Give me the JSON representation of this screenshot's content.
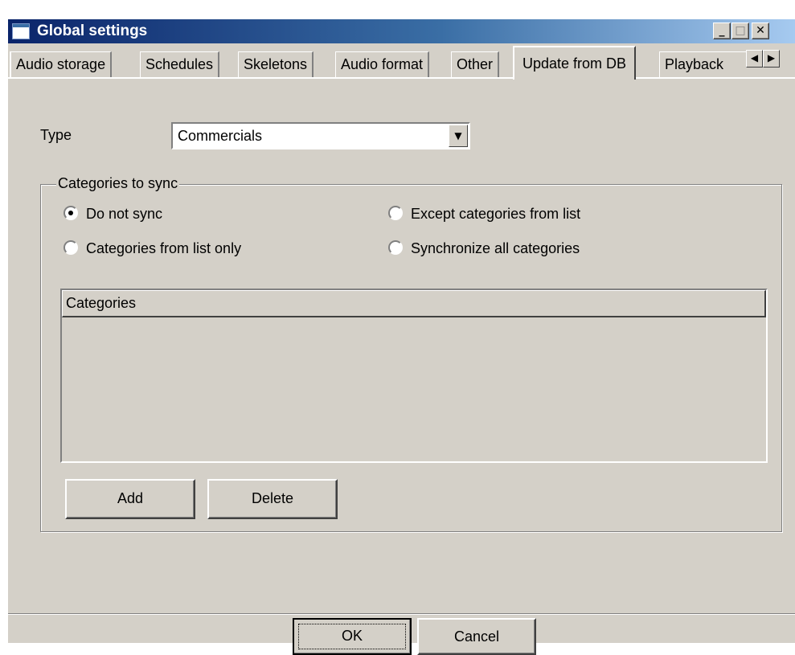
{
  "window": {
    "title": "Global settings"
  },
  "caption_buttons": {
    "minimize": "_",
    "maximize": "□",
    "close": "✕"
  },
  "tabs": [
    {
      "label": "Audio storage",
      "active": false
    },
    {
      "label": "Schedules",
      "active": false
    },
    {
      "label": "Skeletons",
      "active": false
    },
    {
      "label": "Audio format",
      "active": false
    },
    {
      "label": "Other",
      "active": false
    },
    {
      "label": "Update from DB",
      "active": true
    },
    {
      "label": "Playback",
      "active": false
    }
  ],
  "tab_scroll": {
    "left_icon": "◀",
    "right_icon": "▶"
  },
  "type_field": {
    "label": "Type",
    "value": "Commercials",
    "dropdown_icon": "▼"
  },
  "sync_group": {
    "title": "Categories to sync",
    "options": [
      {
        "label": "Do not sync",
        "checked": true
      },
      {
        "label": "Except categories from list",
        "checked": false
      },
      {
        "label": "Categories from list only",
        "checked": false
      },
      {
        "label": "Synchronize all categories",
        "checked": false
      }
    ],
    "list": {
      "column_header": "Categories",
      "rows": []
    },
    "add_label": "Add",
    "delete_label": "Delete"
  },
  "footer": {
    "ok_label": "OK",
    "cancel_label": "Cancel"
  },
  "colors": {
    "window_face": "#d4d0c8",
    "titlebar_start": "#0a246a",
    "titlebar_end": "#a6caf0"
  }
}
